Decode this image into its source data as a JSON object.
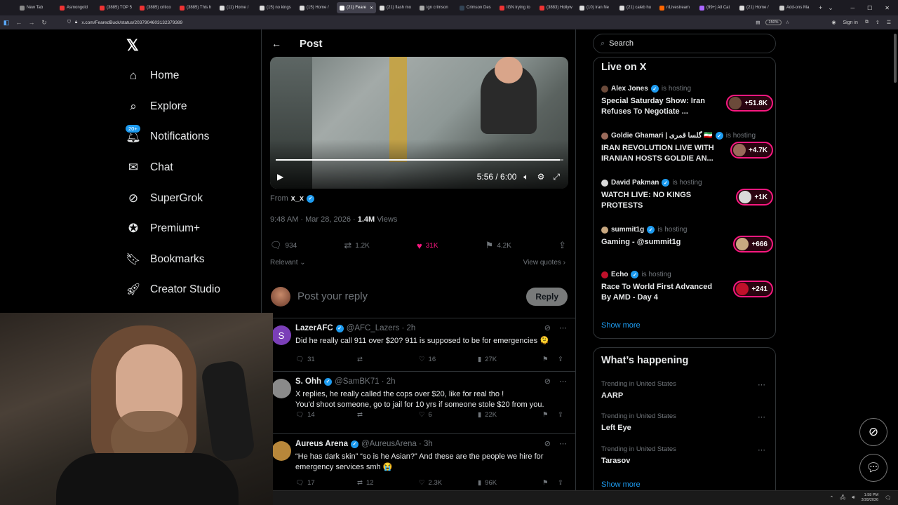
{
  "browser": {
    "tabs": [
      {
        "label": "New Tab",
        "color": "#8a8a8a"
      },
      {
        "label": "Asmongold",
        "color": "#e33"
      },
      {
        "label": "(3885) TOP 5",
        "color": "#e33"
      },
      {
        "label": "(3885) critico",
        "color": "#e33"
      },
      {
        "label": "(3885) This h",
        "color": "#e33"
      },
      {
        "label": "(11) Home /",
        "color": "#ddd"
      },
      {
        "label": "(15) no kings",
        "color": "#ddd"
      },
      {
        "label": "(15) Home /",
        "color": "#ddd"
      },
      {
        "label": "(21) Feare",
        "color": "#fff",
        "active": true
      },
      {
        "label": "(21) flash mo",
        "color": "#ddd"
      },
      {
        "label": "ign crimson",
        "color": "#aaa"
      },
      {
        "label": "Crimson Des",
        "color": "#345"
      },
      {
        "label": "IGN trying to",
        "color": "#e33"
      },
      {
        "label": "(3883) Hollyw",
        "color": "#e33"
      },
      {
        "label": "(10) Iran Ne",
        "color": "#ddd"
      },
      {
        "label": "(21) caleb hu",
        "color": "#ddd"
      },
      {
        "label": "r/Livestream",
        "color": "#f60"
      },
      {
        "label": "(99+) All Cat",
        "color": "#a6f"
      },
      {
        "label": "(21) Home /",
        "color": "#ddd"
      },
      {
        "label": "Add-ons Ma",
        "color": "#ccc"
      }
    ],
    "url": "x.com/FearedBuck/status/2037904603132379389",
    "zoom": "150%",
    "sign_in": "Sign in"
  },
  "nav": {
    "home": "Home",
    "explore": "Explore",
    "notifications": "Notifications",
    "notif_badge": "20+",
    "chat": "Chat",
    "supergrok": "SuperGrok",
    "premium": "Premium+",
    "bookmarks": "Bookmarks",
    "creator": "Creator Studio"
  },
  "post": {
    "title": "Post",
    "video_time": "5:56 / 6:00",
    "video_progress": 0.989,
    "from_label": "From",
    "from_user": "x_x",
    "timestamp": "9:48 AM · Mar 28, 2026 · ",
    "views_count": "1.4M",
    "views_label": " Views",
    "replies": "934",
    "reposts": "1.2K",
    "likes": "31K",
    "bookmarks": "4.2K",
    "relevant": "Relevant",
    "view_quotes": "View quotes",
    "reply_placeholder": "Post your reply",
    "reply_button": "Reply"
  },
  "replies": [
    {
      "name": "LazerAFC",
      "handle": "@AFC_Lazers · 2h",
      "text": "Did he really call 911 over $20? 911 is supposed to be for emergencies 🫠",
      "replies": "31",
      "reposts": "",
      "likes": "16",
      "views": "27K",
      "avatar_color": "#7b3fb8",
      "avatar_letter": "S"
    },
    {
      "name": "S. Ohh",
      "handle": "@SamBK71 · 2h",
      "text": "X replies,  he really called the cops over $20, like for real tho !\nYou'd shoot someone, go to jail for 10 yrs if someone stole $20 from you.",
      "replies": "14",
      "reposts": "",
      "likes": "6",
      "views": "22K",
      "avatar_color": "#8a8a8a",
      "avatar_letter": ""
    },
    {
      "name": "Aureus Arena",
      "handle": "@AureusArena · 3h",
      "text": "“He has dark skin” “so is he Asian?” And these are the people we hire for emergency services smh 😭",
      "replies": "17",
      "reposts": "12",
      "likes": "2.3K",
      "views": "96K",
      "avatar_color": "#b8873a",
      "avatar_letter": ""
    }
  ],
  "search": {
    "placeholder": "Search"
  },
  "live": {
    "title": "Live on X",
    "hosting_label": "is hosting",
    "items": [
      {
        "host": "Alex Jones",
        "title": "Special Saturday Show: Iran Refuses To Negotiate ...",
        "count": "+51.8K",
        "color": "#6b4a3a"
      },
      {
        "host": "Goldie Ghamari | گلسا قمری 🇮🇷",
        "title": "IRAN REVOLUTION LIVE WITH IRANIAN HOSTS GOLDIE AN...",
        "count": "+4.7K",
        "color": "#9a6a5a"
      },
      {
        "host": "David Pakman",
        "title": "WATCH LIVE: NO KINGS PROTESTS",
        "count": "+1K",
        "color": "#d9d9d9"
      },
      {
        "host": "summit1g",
        "title": "Gaming - @summit1g",
        "count": "+666",
        "color": "#c8a880"
      },
      {
        "host": "Echo",
        "title": "Race To World First Advanced By AMD - Day 4",
        "count": "+241",
        "color": "#c0102a"
      }
    ],
    "show_more": "Show more"
  },
  "happening": {
    "title": "What’s happening",
    "trends": [
      {
        "context": "Trending in United States",
        "name": "AARP"
      },
      {
        "context": "Trending in United States",
        "name": "Left Eye"
      },
      {
        "context": "Trending in United States",
        "name": "Tarasov"
      }
    ],
    "show_more": "Show more"
  },
  "taskbar": {
    "time": "1:58 PM",
    "date": "3/28/2026"
  }
}
